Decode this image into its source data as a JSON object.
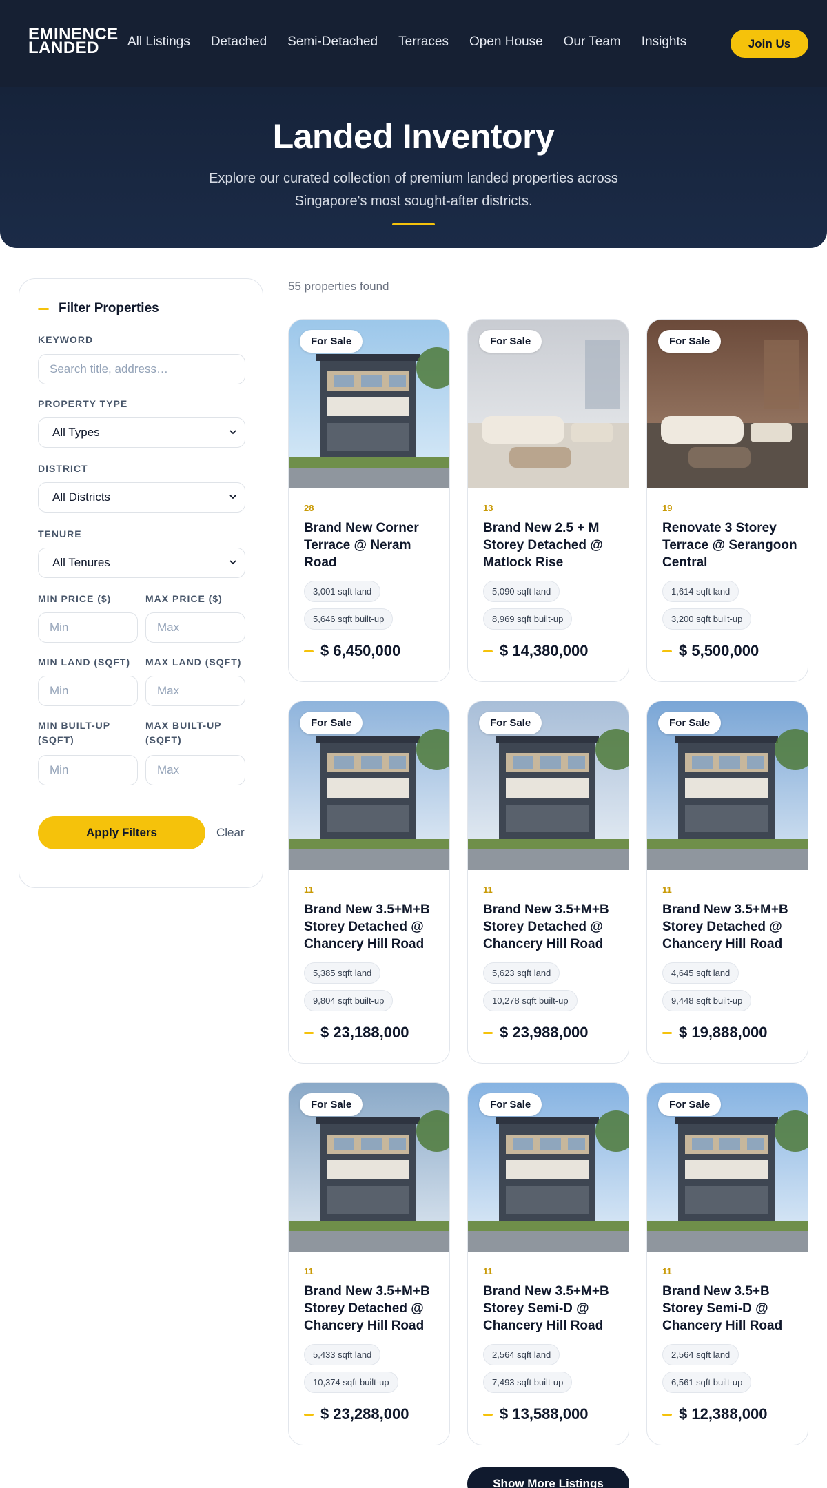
{
  "header": {
    "logo_line1": "EMINENCE",
    "logo_line2": "LANDED",
    "nav": [
      "All Listings",
      "Detached",
      "Semi-Detached",
      "Terraces",
      "Open House",
      "Our Team",
      "Insights"
    ],
    "join_label": "Join Us"
  },
  "hero": {
    "title": "Landed Inventory",
    "subtitle": "Explore our curated collection of premium landed properties across Singapore's most sought-after districts."
  },
  "filters": {
    "title": "Filter Properties",
    "keyword_label": "KEYWORD",
    "keyword_placeholder": "Search title, address…",
    "type_label": "PROPERTY TYPE",
    "type_value": "All Types",
    "district_label": "DISTRICT",
    "district_value": "All Districts",
    "tenure_label": "TENURE",
    "tenure_value": "All Tenures",
    "min_price_label": "MIN PRICE ($)",
    "max_price_label": "MAX PRICE ($)",
    "min_land_label": "MIN LAND (SQFT)",
    "max_land_label": "MAX LAND (SQFT)",
    "min_builtup_label": "MIN BUILT-UP (SQFT)",
    "max_builtup_label": "MAX BUILT-UP (SQFT)",
    "min_placeholder": "Min",
    "max_placeholder": "Max",
    "apply_label": "Apply Filters",
    "clear_label": "Clear"
  },
  "results": {
    "count_text": "55 properties found",
    "more_label": "Show More Listings"
  },
  "listings": [
    {
      "badge": "For Sale",
      "district": "28",
      "title": "Brand New Corner Terrace @ Neram Road",
      "land": "3,001 sqft land",
      "builtup": "5,646 sqft built-up",
      "price": "$ 6,450,000"
    },
    {
      "badge": "For Sale",
      "district": "13",
      "title": "Brand New 2.5 + M Storey Detached @ Matlock Rise",
      "land": "5,090 sqft land",
      "builtup": "8,969 sqft built-up",
      "price": "$ 14,380,000"
    },
    {
      "badge": "For Sale",
      "district": "19",
      "title": "Renovate 3 Storey Terrace @ Serangoon Central",
      "land": "1,614 sqft land",
      "builtup": "3,200 sqft built-up",
      "price": "$ 5,500,000"
    },
    {
      "badge": "For Sale",
      "district": "11",
      "title": "Brand New 3.5+M+B Storey Detached @ Chancery Hill Road",
      "land": "5,385 sqft land",
      "builtup": "9,804 sqft built-up",
      "price": "$ 23,188,000"
    },
    {
      "badge": "For Sale",
      "district": "11",
      "title": "Brand New 3.5+M+B Storey Detached @ Chancery Hill Road",
      "land": "5,623 sqft land",
      "builtup": "10,278 sqft built-up",
      "price": "$ 23,988,000"
    },
    {
      "badge": "For Sale",
      "district": "11",
      "title": "Brand New 3.5+M+B Storey Detached @ Chancery Hill Road",
      "land": "4,645 sqft land",
      "builtup": "9,448 sqft built-up",
      "price": "$ 19,888,000"
    },
    {
      "badge": "For Sale",
      "district": "11",
      "title": "Brand New 3.5+M+B Storey Detached @ Chancery Hill Road",
      "land": "5,433 sqft land",
      "builtup": "10,374 sqft built-up",
      "price": "$ 23,288,000"
    },
    {
      "badge": "For Sale",
      "district": "11",
      "title": "Brand New 3.5+M+B Storey Semi-D @ Chancery Hill Road",
      "land": "2,564 sqft land",
      "builtup": "7,493 sqft built-up",
      "price": "$ 13,588,000"
    },
    {
      "badge": "For Sale",
      "district": "11",
      "title": "Brand New 3.5+B Storey Semi-D @ Chancery Hill Road",
      "land": "2,564 sqft land",
      "builtup": "6,561 sqft built-up",
      "price": "$ 12,388,000"
    }
  ],
  "colors": {
    "navy": "#162033",
    "accent": "#f5c20b"
  }
}
